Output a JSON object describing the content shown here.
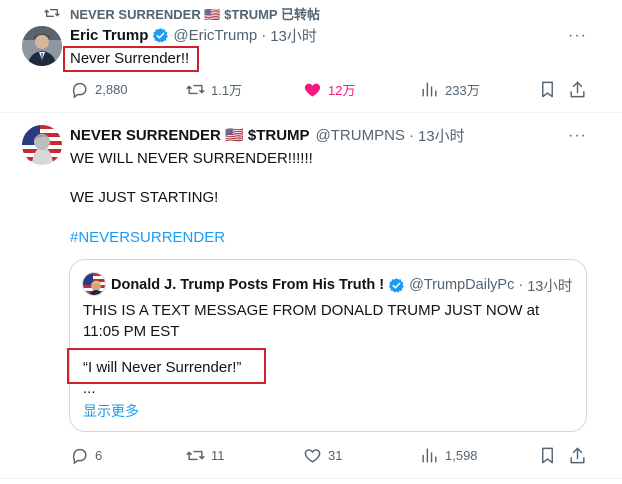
{
  "retweet_header": {
    "label": "NEVER SURRENDER 🇺🇸 $TRUMP 已转帖"
  },
  "tweet1": {
    "author_name": "Eric Trump",
    "handle": "@EricTrump",
    "separator": "·",
    "time": "13小时",
    "text": "Never Surrender!!",
    "stats": {
      "replies": "2,880",
      "retweets": "1.1万",
      "likes": "12万",
      "views": "233万"
    },
    "like_color": "#f91880"
  },
  "tweet2": {
    "author_name": "NEVER SURRENDER 🇺🇸 $TRUMP",
    "handle": "@TRUMPNS",
    "separator": "·",
    "time": "13小时",
    "line1": "WE WILL NEVER SURRENDER!!!!!!",
    "line2": "WE JUST STARTING!",
    "hashtag": "#NEVERSURRENDER",
    "quote": {
      "author_name": "Donald J. Trump Posts From His Truth !",
      "handle": "@TrumpDailyPc",
      "separator": "·",
      "time": "13小时",
      "text": "THIS IS A TEXT MESSAGE FROM DONALD TRUMP JUST NOW at 11:05 PM EST",
      "quote_line": "“I will Never Surrender!”",
      "ellipsis": "...",
      "show_more": "显示更多"
    },
    "stats": {
      "replies": "6",
      "retweets": "11",
      "likes": "31",
      "views": "1,598"
    }
  },
  "colors": {
    "link": "#1d9bf0",
    "highlight_box": "#d0202a",
    "verified": "#1d9bf0"
  }
}
